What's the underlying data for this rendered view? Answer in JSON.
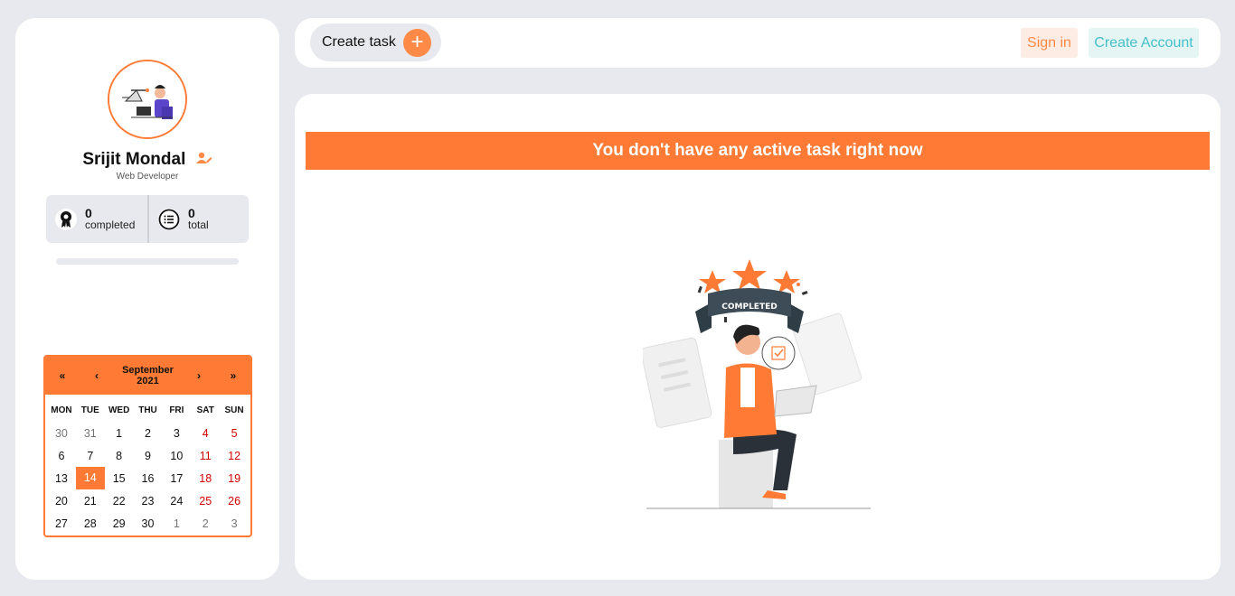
{
  "profile": {
    "name": "Srijit Mondal",
    "role": "Web Developer",
    "completed_count": "0",
    "completed_label": "completed",
    "total_count": "0",
    "total_label": "total",
    "progress_percent": 0
  },
  "calendar": {
    "nav_prev_year": "«",
    "nav_prev": "‹",
    "nav_next": "›",
    "nav_next_year": "»",
    "month": "September",
    "year": "2021",
    "weekdays": [
      "MON",
      "TUE",
      "WED",
      "THU",
      "FRI",
      "SAT",
      "SUN"
    ],
    "weeks": [
      [
        "30",
        "31",
        "1",
        "2",
        "3",
        "4",
        "5"
      ],
      [
        "6",
        "7",
        "8",
        "9",
        "10",
        "11",
        "12"
      ],
      [
        "13",
        "14",
        "15",
        "16",
        "17",
        "18",
        "19"
      ],
      [
        "20",
        "21",
        "22",
        "23",
        "24",
        "25",
        "26"
      ],
      [
        "27",
        "28",
        "29",
        "30",
        "1",
        "2",
        "3"
      ]
    ],
    "today": "14"
  },
  "toolbar": {
    "create_task_label": "Create task",
    "create_task_icon": "+",
    "sign_in_label": "Sign in",
    "create_account_label": "Create Account"
  },
  "main": {
    "banner_text": "You don't have any active task right now",
    "illustration_ribbon": "COMPLETED"
  },
  "colors": {
    "accent": "#ff7b35",
    "teal": "#45c0c9",
    "weekend": "#d10000"
  }
}
